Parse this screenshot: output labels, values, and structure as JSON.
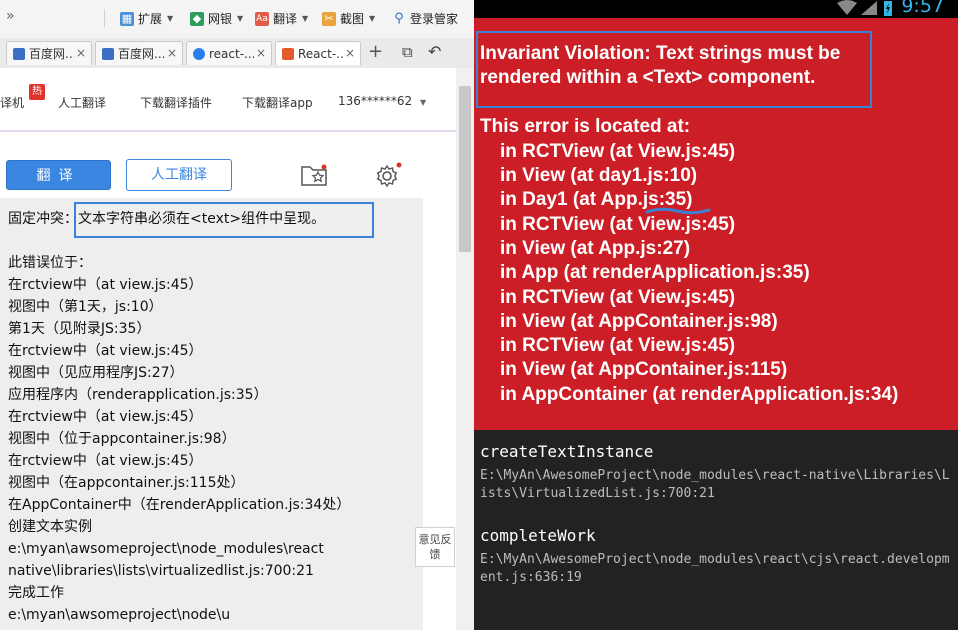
{
  "browser": {
    "toolbar": {
      "overflow": "»",
      "items": [
        {
          "label": "扩展"
        },
        {
          "label": "网银"
        },
        {
          "label": "翻译"
        },
        {
          "label": "截图"
        },
        {
          "label": "登录管家"
        }
      ]
    },
    "tabs": [
      {
        "title": "百度网..."
      },
      {
        "title": "百度网..."
      },
      {
        "title": "react-..."
      },
      {
        "title": "React-..."
      }
    ],
    "tab_close": "×",
    "new_tab": "+",
    "tab_actions": [
      "⧉",
      "↶"
    ]
  },
  "translator": {
    "nav": {
      "item0": "译机",
      "hot_badge": "热",
      "item1": "人工翻译",
      "item2": "下载翻译插件",
      "item3": "下载翻译app",
      "user": "136******62"
    },
    "translate_button": "翻译",
    "human_translate_button": "人工翻译",
    "output_lines": [
      "固定冲突：文本字符串必须在<text>组件中呈现。",
      "",
      "此错误位于：",
      "在rctview中（at view.js:45）",
      "视图中（第1天，js:10）",
      "第1天（见附录JS:35）",
      "在rctview中（at view.js:45）",
      "视图中（见应用程序JS:27）",
      "应用程序内（renderapplication.js:35）",
      "在rctview中（at view.js:45）",
      "视图中（位于appcontainer.js:98）",
      "在rctview中（at view.js:45）",
      "视图中（在appcontainer.js:115处）",
      "在AppContainer中（在renderApplication.js:34处）",
      "创建文本实例",
      "e:\\myan\\awsomeproject\\node_modules\\react",
      "native\\libraries\\lists\\virtualizedlist.js:700:21",
      "完成工作",
      "e:\\myan\\awsomeproject\\node\\u"
    ],
    "feedback": "意见反馈"
  },
  "android": {
    "clock": "9:57",
    "error_title": "Invariant Violation: Text strings must be rendered within a <Text> component.",
    "stack_heading": "This error is located at:",
    "stack": [
      "in RCTView (at View.js:45)",
      "in View (at day1.js:10)",
      "in Day1 (at App.js:35)",
      "in RCTView (at View.js:45)",
      "in View (at App.js:27)",
      "in App (at renderApplication.js:35)",
      "in RCTView (at View.js:45)",
      "in View (at AppContainer.js:98)",
      "in RCTView (at View.js:45)",
      "in View (at AppContainer.js:115)",
      "in AppContainer (at renderApplication.js:34)"
    ],
    "frames": [
      {
        "fn": "createTextInstance",
        "path": "E:\\MyAn\\AwesomeProject\\node_modules\\react-native\\Libraries\\Lists\\VirtualizedList.js:700:21"
      },
      {
        "fn": "completeWork",
        "path": "E:\\MyAn\\AwesomeProject\\node_modules\\react\\cjs\\react.development.js:636:19"
      }
    ]
  },
  "colors": {
    "error_red": "#cc1e26",
    "highlight_blue": "#3a82d6",
    "translate_blue": "#3b86e0",
    "android_dark": "#222222",
    "clock_blue": "#33b5e5"
  }
}
